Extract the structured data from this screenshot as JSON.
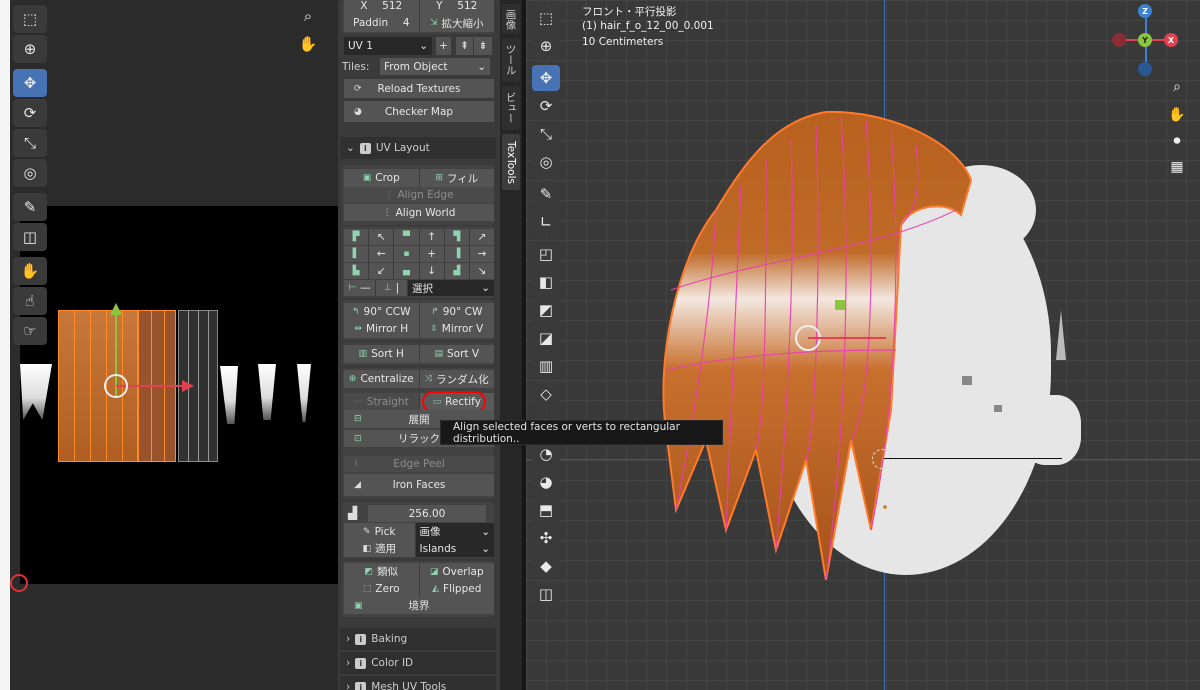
{
  "uv_editor": {
    "tools": [
      "select-box-icon",
      "cursor-icon",
      "move-icon",
      "rotate-icon",
      "scale-icon",
      "transform-icon",
      "annotate-icon",
      "grab-icon",
      "pinch-icon",
      "relax-icon"
    ]
  },
  "side_panel": {
    "size": {
      "x_label": "X",
      "x_value": "512",
      "y_label": "Y",
      "y_value": "512"
    },
    "padding": {
      "label": "Paddin",
      "value": "4",
      "button": "拡大縮小"
    },
    "uv_map": {
      "value": "UV 1"
    },
    "tiles": {
      "label": "Tiles:",
      "value": "From Object"
    },
    "reload_textures": "Reload Textures",
    "checker_map": "Checker Map",
    "uv_layout_header": "UV Layout",
    "crop": "Crop",
    "fill": "フィル",
    "align_edge": "Align Edge",
    "align_world": "Align World",
    "align_select": "選択",
    "rotate_ccw": "90° CCW",
    "rotate_cw": "90° CW",
    "mirror_h": "Mirror H",
    "mirror_v": "Mirror V",
    "sort_h": "Sort H",
    "sort_v": "Sort V",
    "centralize": "Centralize",
    "random": "ランダム化",
    "straight": "Straight",
    "rectify": "Rectify",
    "unfold": "展開",
    "relax": "リラック",
    "edge_peel": "Edge Peel",
    "iron_faces": "Iron Faces",
    "texel_value": "256.00",
    "pick": "Pick",
    "pick_mode": "画像",
    "apply": "適用",
    "apply_mode": "Islands",
    "similar": "類似",
    "overlap": "Overlap",
    "zero": "Zero",
    "flipped": "Flipped",
    "boundary": "境界",
    "baking_header": "Baking",
    "color_id_header": "Color ID",
    "mesh_uv_tools_header": "Mesh UV Tools"
  },
  "tabs": [
    "画像",
    "ツール",
    "ビュー",
    "TexTools"
  ],
  "viewport": {
    "view_name": "フロント・平行投影",
    "object_name": "(1) hair_f_o_12_00_0.001",
    "scale": "10 Centimeters",
    "gizmo": {
      "x": "X",
      "y": "Y",
      "z": "Z"
    },
    "colors": {
      "x": "#e0434f",
      "y": "#8bc53f",
      "z": "#3c82d2"
    }
  },
  "tooltip": "Align selected faces or verts to rectangular distribution..",
  "colors": {
    "accent": "#4772b3",
    "highlight": "#ff0000",
    "uv_orange": "#c1692a"
  }
}
